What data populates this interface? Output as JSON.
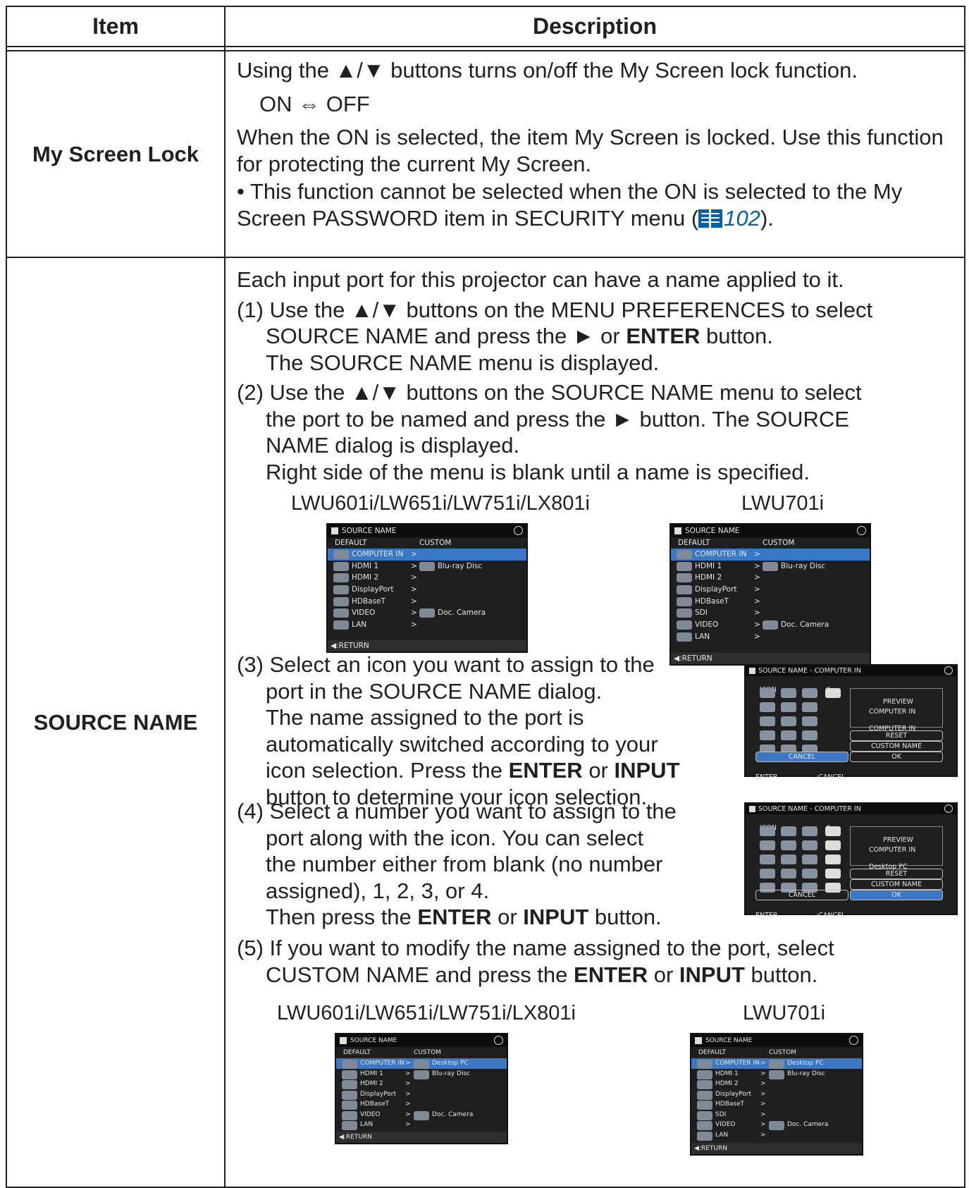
{
  "header": {
    "item": "Item",
    "description": "Description"
  },
  "lock": {
    "item": "My Screen Lock",
    "line1": "Using the ▲/▼ buttons turns on/off the My Screen lock function.",
    "line2": "ON ⇔ OFF",
    "para": "When the ON is selected, the item My Screen is locked. Use this function for protecting the current My Screen.",
    "bullet_a": "• This function cannot be selected when the ON is selected to the My Screen PASSWORD item in SECURITY menu (",
    "ref": "102",
    "bullet_b": ")."
  },
  "source": {
    "item": "SOURCE NAME",
    "intro": "Each input port for this projector can have a name applied to it.",
    "s1a": "(1) Use the ▲/▼ buttons on the MENU PREFERENCES to select",
    "s1b": "SOURCE NAME and press the ► or ",
    "enter": "ENTER",
    "s1c": " button.",
    "s1d": "The SOURCE NAME menu is displayed.",
    "s2a": "(2) Use the ▲/▼ buttons on the SOURCE NAME menu to select",
    "s2b": "the port to be named and press the ► button. The SOURCE",
    "s2c": "NAME dialog is displayed.",
    "s2d": "Right side of the menu is blank until a name is specified.",
    "model_a": "LWU601i/LW651i/LW751i/LX801i",
    "model_b": "LWU701i",
    "s3a": "(3) Select an icon you want to assign to the",
    "s3b": "port in the SOURCE NAME dialog.",
    "s3c": "The name assigned to the port is",
    "s3d": "automatically switched according to your",
    "s3e": "icon selection. Press the ",
    "or": " or ",
    "input": "INPUT",
    "s3f": "button to determine your icon selection.",
    "s4a": "(4) Select a number you want to assign to the",
    "s4b": "port along with the icon. You can select",
    "s4c": "the number either from blank (no number",
    "s4d": "assigned), 1, 2, 3, or 4.",
    "s4e": "Then press the ",
    "button_end": " button.",
    "s5a": "(5) If you want to modify the name assigned to the port, select",
    "s5b": "CUSTOM NAME and press the "
  },
  "screens": {
    "title": "SOURCE NAME",
    "default": "DEFAULT",
    "custom": "CUSTOM",
    "return": "◀:RETURN",
    "ports_a": [
      "COMPUTER IN",
      "HDMI 1",
      "HDMI 2",
      "DisplayPort",
      "HDBaseT",
      "VIDEO",
      "LAN"
    ],
    "ports_b": [
      "COMPUTER IN",
      "HDMI 1",
      "HDMI 2",
      "DisplayPort",
      "HDBaseT",
      "SDI",
      "VIDEO",
      "LAN"
    ],
    "arrow": ">",
    "bluray": "Blu-ray Disc",
    "doccam": "Doc. Camera",
    "desktop": "Desktop PC",
    "dlg_title": "SOURCE NAME - COMPUTER IN",
    "icon": "ICON",
    "hash": "#",
    "preview": "PREVIEW",
    "computer_in": "COMPUTER IN",
    "reset": "RESET",
    "custom_name": "CUSTOM NAME",
    "cancel": "CANCEL",
    "ok": "OK",
    "enter_key": "ENTER",
    "cancel_key": ":CANCEL"
  }
}
